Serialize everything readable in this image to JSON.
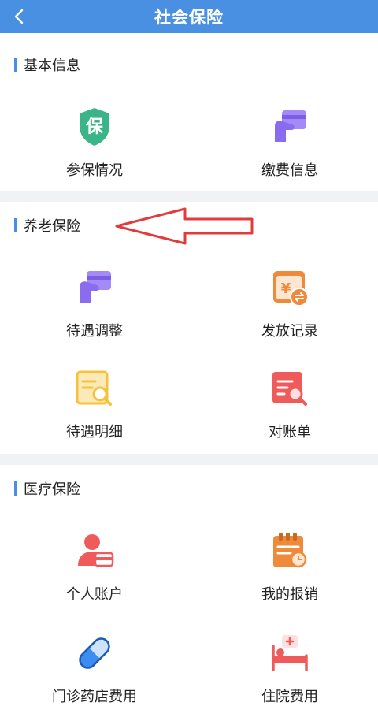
{
  "header": {
    "title": "社会保险"
  },
  "sections": {
    "basic": {
      "title": "基本信息",
      "items": [
        {
          "label": "参保情况",
          "icon": "shield-icon"
        },
        {
          "label": "缴费信息",
          "icon": "card-payment-icon"
        }
      ]
    },
    "pension": {
      "title": "养老保险",
      "items": [
        {
          "label": "待遇调整",
          "icon": "card-hand-icon"
        },
        {
          "label": "发放记录",
          "icon": "yuan-transfer-icon"
        },
        {
          "label": "待遇明细",
          "icon": "document-search-icon"
        },
        {
          "label": "对账单",
          "icon": "statement-search-icon"
        }
      ]
    },
    "medical": {
      "title": "医疗保险",
      "items": [
        {
          "label": "个人账户",
          "icon": "person-card-icon"
        },
        {
          "label": "我的报销",
          "icon": "clipboard-icon"
        },
        {
          "label": "门诊药店费用",
          "icon": "pill-icon"
        },
        {
          "label": "住院费用",
          "icon": "hospital-bed-icon"
        }
      ]
    }
  },
  "colors": {
    "header": "#4a90e2",
    "green": "#3bb48a",
    "purple": "#8a6cf0",
    "orange": "#ef8a3a",
    "yellow": "#f5c33b",
    "red": "#ef5b5b",
    "blue": "#3b8ef0",
    "arrow": "#e23b3b"
  }
}
